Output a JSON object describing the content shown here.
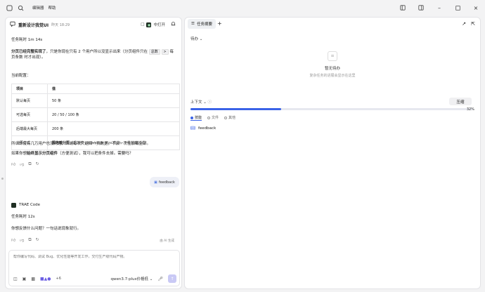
{
  "titlebar": {
    "menu": [
      "编辑器",
      "帮助"
    ]
  },
  "chat": {
    "title": "重新设计我觉UI",
    "time": "昨天 18:29",
    "mode_label": "中打开",
    "task_time_1": "任务耗时 1m 14s",
    "para1_pre": "分页已经完整实现了",
    "para1_mid": "，只是你现在只有 2 个用户所以没显示出来（分页组件只在 ",
    "para1_kbd1": "总数",
    "para1_kbd2": ">",
    "para1_post": " 每页条数 时才出现）。",
    "current_config": "当前配置：",
    "table": {
      "headers": [
        "项目",
        "值"
      ],
      "rows": [
        [
          "默认每页",
          "50 条"
        ],
        [
          "可选每页",
          "20 / 50 / 100 条"
        ],
        [
          "后端最大每页",
          "200 条"
        ],
        [
          "分页方式",
          "服务端分页",
          "（后端按 page/page_size 查询，不是前端过滤）"
        ]
      ]
    },
    "para2": "所以即使有几万用户也没问题，后端每次只返回一页数据，不会一次性加载全部。",
    "para3_pre": "如果你想",
    "para3_bold": "始终显示分页组件",
    "para3_post": "（方便测试），我可以把条件去掉。需要吗？",
    "user_bubble": "feedback",
    "agent_name": "TRAE Code",
    "task_time_2": "任务耗时 12s",
    "reply": "你想反馈什么问题？一句话说现象就行。",
    "ai_tag": "由 AI 生成",
    "input_placeholder": "帮你编写代码、调试 Bug、优化性能等开发工作，交付生产级代码产物。",
    "plus_count": "+6",
    "model": "qwen3.7-plus价格低"
  },
  "right": {
    "tab_label": "任务摘要",
    "todo_label": "待办",
    "empty_title": "暂无待办",
    "empty_desc": "复杂任务的进展会显示在这里",
    "context_label": "上下文",
    "compress_label": "压缩",
    "progress_percent": "32%",
    "progress_value": 0.32,
    "subtabs": [
      "技能",
      "文件",
      "其他"
    ],
    "skill_item": "feedback"
  }
}
